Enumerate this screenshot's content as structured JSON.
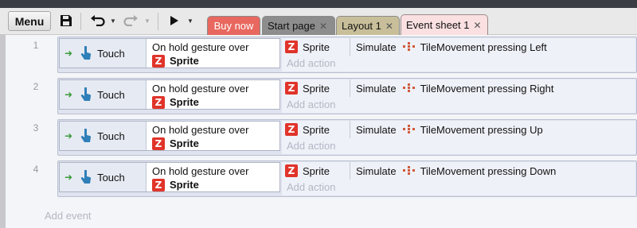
{
  "toolbar": {
    "menu_label": "Menu",
    "save_icon": "save-icon",
    "undo_icon": "undo-icon",
    "redo_icon": "redo-icon",
    "play_icon": "play-icon"
  },
  "tabs": [
    {
      "label": "Buy now",
      "color": "#e8685f"
    },
    {
      "label": "Start page"
    },
    {
      "label": "Layout 1"
    },
    {
      "label": "Event sheet 1",
      "active": true
    }
  ],
  "events": [
    {
      "number": "1",
      "cond_object": "Touch",
      "cond_line1": "On hold gesture over",
      "cond_target": "Sprite",
      "act_object": "Sprite",
      "act_simulate": "Simulate",
      "act_detail": "TileMovement pressing Left",
      "add_action": "Add action"
    },
    {
      "number": "2",
      "cond_object": "Touch",
      "cond_line1": "On hold gesture over",
      "cond_target": "Sprite",
      "act_object": "Sprite",
      "act_simulate": "Simulate",
      "act_detail": "TileMovement pressing Right",
      "add_action": "Add action"
    },
    {
      "number": "3",
      "cond_object": "Touch",
      "cond_line1": "On hold gesture over",
      "cond_target": "Sprite",
      "act_object": "Sprite",
      "act_simulate": "Simulate",
      "act_detail": "TileMovement pressing Up",
      "add_action": "Add action"
    },
    {
      "number": "4",
      "cond_object": "Touch",
      "cond_line1": "On hold gesture over",
      "cond_target": "Sprite",
      "act_object": "Sprite",
      "act_simulate": "Simulate",
      "act_detail": "TileMovement pressing Down",
      "add_action": "Add action"
    }
  ],
  "sheet": {
    "add_event": "Add event"
  },
  "icon_letters": {
    "sprite": "Z"
  }
}
